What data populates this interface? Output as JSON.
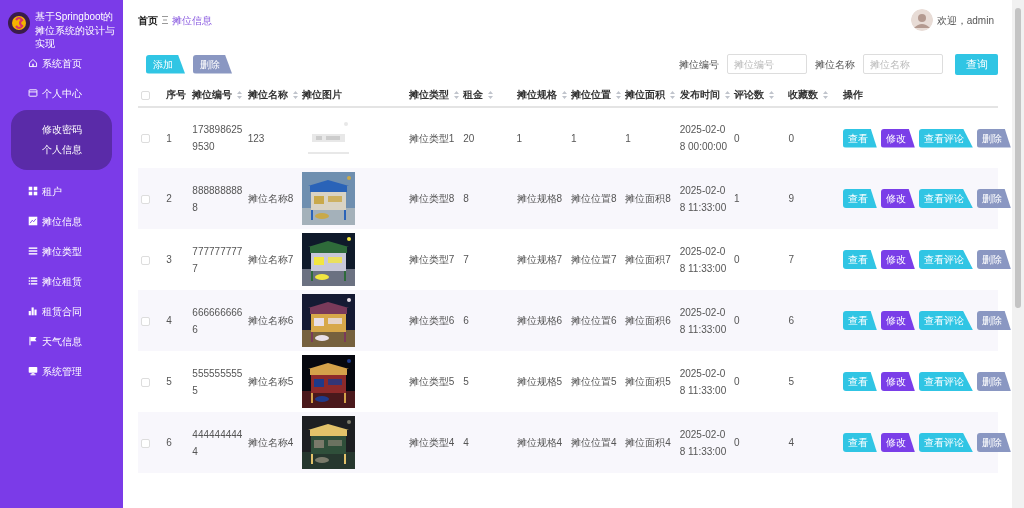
{
  "app": {
    "title": "基于Springboot的摊位系统的设计与实现"
  },
  "sidebar": {
    "items": [
      {
        "label": "系统首页"
      },
      {
        "label": "个人中心",
        "children": [
          {
            "label": "修改密码"
          },
          {
            "label": "个人信息"
          }
        ]
      },
      {
        "label": "租户"
      },
      {
        "label": "摊位信息"
      },
      {
        "label": "摊位类型"
      },
      {
        "label": "摊位租赁"
      },
      {
        "label": "租赁合同"
      },
      {
        "label": "天气信息"
      },
      {
        "label": "系统管理"
      }
    ]
  },
  "breadcrumb": [
    "首页",
    "摊位信息"
  ],
  "user": {
    "greeting": "欢迎，admin"
  },
  "toolbar": {
    "buttons": [
      {
        "label": "添加",
        "kind": "add"
      },
      {
        "label": "删除",
        "kind": "delete"
      }
    ]
  },
  "search": {
    "fields": [
      {
        "label": "摊位编号",
        "placeholder": "摊位编号"
      },
      {
        "label": "摊位名称",
        "placeholder": "摊位名称"
      }
    ],
    "button": "查询"
  },
  "table": {
    "select_all": {
      "checked": false
    },
    "columns": [
      {
        "label": "序号",
        "sortable": false
      },
      {
        "label": "摊位编号",
        "sortable": true
      },
      {
        "label": "摊位名称",
        "sortable": true
      },
      {
        "label": "摊位图片",
        "sortable": false
      },
      {
        "label": "摊位类型",
        "sortable": true
      },
      {
        "label": "租金",
        "sortable": true
      },
      {
        "label": "摊位规格",
        "sortable": true
      },
      {
        "label": "摊位位置",
        "sortable": true
      },
      {
        "label": "摊位面积",
        "sortable": true
      },
      {
        "label": "发布时间",
        "sortable": true
      },
      {
        "label": "评论数",
        "sortable": true
      },
      {
        "label": "收藏数",
        "sortable": true
      },
      {
        "label": "操作",
        "sortable": false
      }
    ],
    "rows": [
      {
        "checked": false,
        "cells": [
          "1",
          "1738986259530",
          "123",
          {
            "kind": "picture"
          },
          "摊位类型1",
          "20",
          "1",
          "1",
          "1",
          "2025-02-08 00:00:00",
          "0",
          "0"
        ],
        "actions": [
          {
            "label": "查看",
            "kind": "view"
          },
          {
            "label": "修改",
            "kind": "edit"
          },
          {
            "label": "查看评论",
            "kind": "view"
          },
          {
            "label": "删除",
            "kind": "delete"
          }
        ]
      },
      {
        "checked": false,
        "cells": [
          "2",
          "8888888888",
          "摊位名称8",
          {
            "kind": "picture"
          },
          "摊位类型8",
          "8",
          "摊位规格8",
          "摊位位置8",
          "摊位面积8",
          "2025-02-08 11:33:00",
          "1",
          "9"
        ],
        "actions": [
          {
            "label": "查看",
            "kind": "view"
          },
          {
            "label": "修改",
            "kind": "edit"
          },
          {
            "label": "查看评论",
            "kind": "view"
          },
          {
            "label": "删除",
            "kind": "delete"
          }
        ]
      },
      {
        "checked": false,
        "cells": [
          "3",
          "7777777777",
          "摊位名称7",
          {
            "kind": "picture"
          },
          "摊位类型7",
          "7",
          "摊位规格7",
          "摊位位置7",
          "摊位面积7",
          "2025-02-08 11:33:00",
          "0",
          "7"
        ],
        "actions": [
          {
            "label": "查看",
            "kind": "view"
          },
          {
            "label": "修改",
            "kind": "edit"
          },
          {
            "label": "查看评论",
            "kind": "view"
          },
          {
            "label": "删除",
            "kind": "delete"
          }
        ]
      },
      {
        "checked": false,
        "cells": [
          "4",
          "6666666666",
          "摊位名称6",
          {
            "kind": "picture"
          },
          "摊位类型6",
          "6",
          "摊位规格6",
          "摊位位置6",
          "摊位面积6",
          "2025-02-08 11:33:00",
          "0",
          "6"
        ],
        "actions": [
          {
            "label": "查看",
            "kind": "view"
          },
          {
            "label": "修改",
            "kind": "edit"
          },
          {
            "label": "查看评论",
            "kind": "view"
          },
          {
            "label": "删除",
            "kind": "delete"
          }
        ]
      },
      {
        "checked": false,
        "cells": [
          "5",
          "5555555555",
          "摊位名称5",
          {
            "kind": "picture"
          },
          "摊位类型5",
          "5",
          "摊位规格5",
          "摊位位置5",
          "摊位面积5",
          "2025-02-08 11:33:00",
          "0",
          "5"
        ],
        "actions": [
          {
            "label": "查看",
            "kind": "view"
          },
          {
            "label": "修改",
            "kind": "edit"
          },
          {
            "label": "查看评论",
            "kind": "view"
          },
          {
            "label": "删除",
            "kind": "delete"
          }
        ]
      },
      {
        "checked": false,
        "cells": [
          "6",
          "4444444444",
          "摊位名称4",
          {
            "kind": "picture"
          },
          "摊位类型4",
          "4",
          "摊位规格4",
          "摊位位置4",
          "摊位面积4",
          "2025-02-08 11:33:00",
          "0",
          "4"
        ],
        "actions": [
          {
            "label": "查看",
            "kind": "view"
          },
          {
            "label": "修改",
            "kind": "edit"
          },
          {
            "label": "查看评论",
            "kind": "view"
          },
          {
            "label": "删除",
            "kind": "delete"
          }
        ]
      }
    ]
  }
}
